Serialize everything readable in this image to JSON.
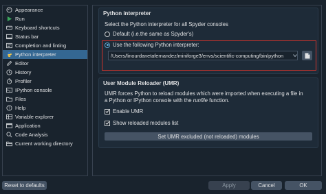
{
  "sidebar": {
    "items": [
      {
        "label": "Appearance",
        "icon": "palette-icon",
        "color": "#e0e1e3"
      },
      {
        "label": "Run",
        "icon": "play-icon",
        "color": "#3ca55c"
      },
      {
        "label": "Keyboard shortcuts",
        "icon": "keyboard-icon",
        "color": "#e0e1e3"
      },
      {
        "label": "Status bar",
        "icon": "statusbar-icon",
        "color": "#e0e1e3"
      },
      {
        "label": "Completion and linting",
        "icon": "completion-icon",
        "color": "#e0e1e3"
      },
      {
        "label": "Python interpreter",
        "icon": "python-icon",
        "color": "#f5c542",
        "selected": true
      },
      {
        "label": "Editor",
        "icon": "editor-icon",
        "color": "#e0e1e3"
      },
      {
        "label": "History",
        "icon": "history-icon",
        "color": "#e0e1e3"
      },
      {
        "label": "Profiler",
        "icon": "profiler-icon",
        "color": "#e0e1e3"
      },
      {
        "label": "IPython console",
        "icon": "console-icon",
        "color": "#e0e1e3"
      },
      {
        "label": "Files",
        "icon": "folder-icon",
        "color": "#e0e1e3"
      },
      {
        "label": "Help",
        "icon": "help-icon",
        "color": "#e0e1e3"
      },
      {
        "label": "Variable explorer",
        "icon": "variable-explorer-icon",
        "color": "#e0e1e3"
      },
      {
        "label": "Application",
        "icon": "application-icon",
        "color": "#e0e1e3"
      },
      {
        "label": "Code Analysis",
        "icon": "code-analysis-icon",
        "color": "#e0e1e3"
      },
      {
        "label": "Current working directory",
        "icon": "folder-open-icon",
        "color": "#e0e1e3"
      }
    ]
  },
  "interpreter": {
    "title": "Python interpreter",
    "description": "Select the Python interpreter for all Spyder consoles",
    "default_label": "Default (i.e.the same as Spyder's)",
    "custom_label": "Use the following Python interpreter:",
    "path_value": "/Users/linourdanetafernandez/miniforge3/envs/scientific-computing/bin/python",
    "selected_option": "custom"
  },
  "umr": {
    "title": "User Module Reloader (UMR)",
    "description_line1": "UMR forces Python to reload modules which were imported when executing a file in",
    "description_line2_prefix": "a Python or IPython console with the ",
    "description_line2_italic": "runfile",
    "description_line2_suffix": " function.",
    "enable_label": "Enable UMR",
    "enable_checked": true,
    "show_reloaded_label": "Show reloaded modules list",
    "show_reloaded_checked": true,
    "set_excluded_label": "Set UMR excluded (not reloaded) modules"
  },
  "footer": {
    "reset_label": "Reset to defaults",
    "apply_label": "Apply",
    "cancel_label": "Cancel",
    "ok_label": "OK"
  },
  "colors": {
    "background": "#19232d",
    "selection": "#346792",
    "accent": "#5fa8d3",
    "highlight_border": "#d0342c"
  }
}
